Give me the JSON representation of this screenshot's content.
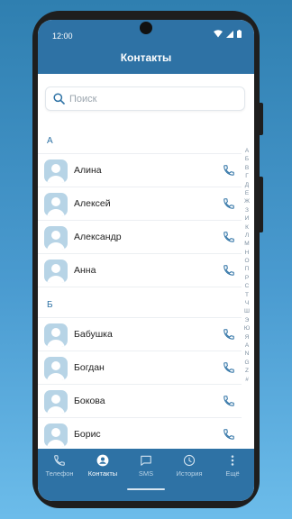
{
  "status_bar": {
    "time": "12:00"
  },
  "header": {
    "title": "Контакты"
  },
  "search": {
    "placeholder": "Поиск"
  },
  "sections": [
    {
      "letter": "А",
      "contacts": [
        "Алина",
        "Алексей",
        "Александр",
        "Анна"
      ]
    },
    {
      "letter": "Б",
      "contacts": [
        "Бабушка",
        "Богдан",
        "Бокова",
        "Борис"
      ]
    }
  ],
  "alphabet_index": [
    "А",
    "Б",
    "В",
    "Г",
    "Д",
    "Е",
    "Ж",
    "З",
    "И",
    "К",
    "Л",
    "М",
    "Н",
    "О",
    "П",
    "Р",
    "С",
    "Т",
    "Ч",
    "Ш",
    "Э",
    "Ю",
    "Я",
    "A",
    "N",
    "G",
    "Z",
    "#"
  ],
  "bottom_nav": [
    {
      "label": "Телефон",
      "icon": "phone-icon",
      "active": false
    },
    {
      "label": "Контакты",
      "icon": "person-icon",
      "active": true
    },
    {
      "label": "SMS",
      "icon": "message-icon",
      "active": false
    },
    {
      "label": "История",
      "icon": "clock-icon",
      "active": false
    },
    {
      "label": "Ещё",
      "icon": "more-icon",
      "active": false
    }
  ],
  "colors": {
    "accent": "#2e72a5",
    "avatar": "#b7d4e6",
    "background_top": "#2f7fb0",
    "background_bottom": "#6cbcea"
  }
}
